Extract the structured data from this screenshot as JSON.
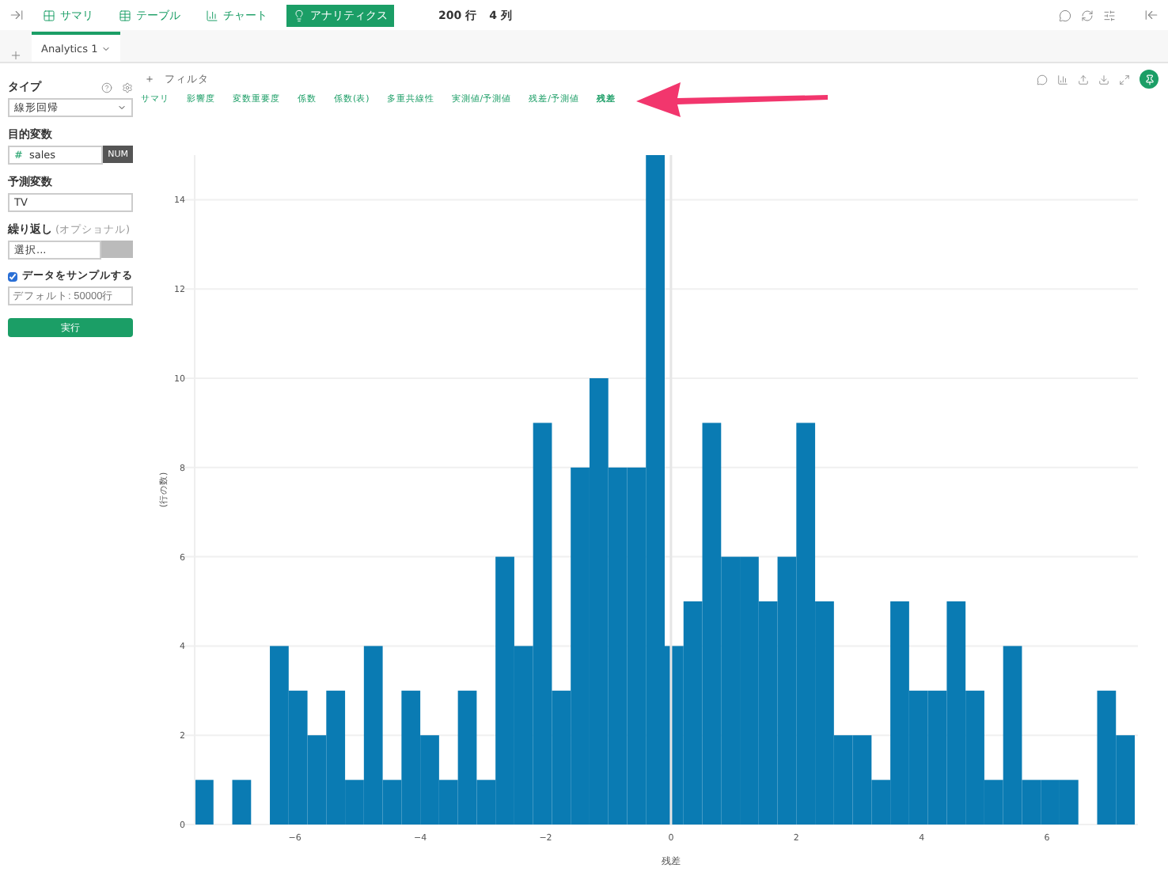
{
  "toolbar": {
    "views": [
      {
        "label": "サマリ",
        "selected": false
      },
      {
        "label": "テーブル",
        "selected": false
      },
      {
        "label": "チャート",
        "selected": false
      },
      {
        "label": "アナリティクス",
        "selected": true
      }
    ],
    "rows": "200 行",
    "cols": "4 列"
  },
  "tabs": [
    {
      "label": "Analytics 1",
      "selected": true
    }
  ],
  "sidebar": {
    "type_label": "タイプ",
    "type_value": "線形回帰",
    "target_label": "目的変数",
    "target_icon": "#",
    "target_value": "sales",
    "target_badge": "NUM",
    "predictor_label": "予測変数",
    "predictor_value": "TV",
    "repeat_label": "繰り返し",
    "repeat_optional": "(オプショナル)",
    "repeat_value": "選択...",
    "sample": {
      "label": "データをサンプルする",
      "checked": true
    },
    "sample_placeholder": "デフォルト: 50000行",
    "run": "実行"
  },
  "filter_icon": "＋",
  "filter": "フィルタ",
  "subtabs": [
    {
      "label": "サマリ",
      "selected": false
    },
    {
      "label": "影響度",
      "selected": false
    },
    {
      "label": "変数重要度",
      "selected": false
    },
    {
      "label": "係数",
      "selected": false
    },
    {
      "label": "係数(表)",
      "selected": false
    },
    {
      "label": "多重共線性",
      "selected": false
    },
    {
      "label": "実測値/予測値",
      "selected": false
    },
    {
      "label": "残差/予測値",
      "selected": false
    },
    {
      "label": "残差",
      "selected": true
    }
  ],
  "chart_data": {
    "type": "bar",
    "xlabel": "残差",
    "ylabel": "(行の数)",
    "x": [
      -7.45,
      -7.15,
      -6.85,
      -6.55,
      -6.25,
      -5.95,
      -5.65,
      -5.35,
      -5.05,
      -4.75,
      -4.45,
      -4.15,
      -3.85,
      -3.55,
      -3.25,
      -2.95,
      -2.65,
      -2.35,
      -2.05,
      -1.75,
      -1.45,
      -1.15,
      -0.85,
      -0.55,
      -0.25,
      0.05,
      0.35,
      0.65,
      0.95,
      1.25,
      1.55,
      1.85,
      2.15,
      2.45,
      2.75,
      3.05,
      3.35,
      3.65,
      3.95,
      4.25,
      4.55,
      4.85,
      5.15,
      5.45,
      5.75,
      6.05,
      6.35,
      6.65,
      6.95,
      7.25
    ],
    "values": [
      1,
      0,
      1,
      0,
      4,
      3,
      2,
      3,
      1,
      4,
      1,
      3,
      2,
      1,
      3,
      1,
      6,
      4,
      9,
      3,
      8,
      10,
      8,
      8,
      15,
      4,
      5,
      9,
      6,
      6,
      5,
      6,
      9,
      5,
      2,
      2,
      1,
      5,
      3,
      3,
      5,
      3,
      1,
      4,
      1,
      1,
      1,
      0,
      3,
      2
    ],
    "xlim": [
      -7.6,
      7.4
    ],
    "ylim": [
      0,
      15
    ],
    "grid": true,
    "xticks": [
      {
        "value": -6,
        "label": "−6"
      },
      {
        "value": -4,
        "label": "−4"
      },
      {
        "value": -2,
        "label": "−2"
      },
      {
        "value": 0,
        "label": "0"
      },
      {
        "value": 2,
        "label": "2"
      },
      {
        "value": 4,
        "label": "4"
      },
      {
        "value": 6,
        "label": "6"
      }
    ],
    "yticks": [
      {
        "value": 0,
        "label": "0"
      },
      {
        "value": 2,
        "label": "2"
      },
      {
        "value": 4,
        "label": "4"
      },
      {
        "value": 6,
        "label": "6"
      },
      {
        "value": 8,
        "label": "8"
      },
      {
        "value": 10,
        "label": "10"
      },
      {
        "value": 12,
        "label": "12"
      },
      {
        "value": 14,
        "label": "14"
      }
    ]
  }
}
